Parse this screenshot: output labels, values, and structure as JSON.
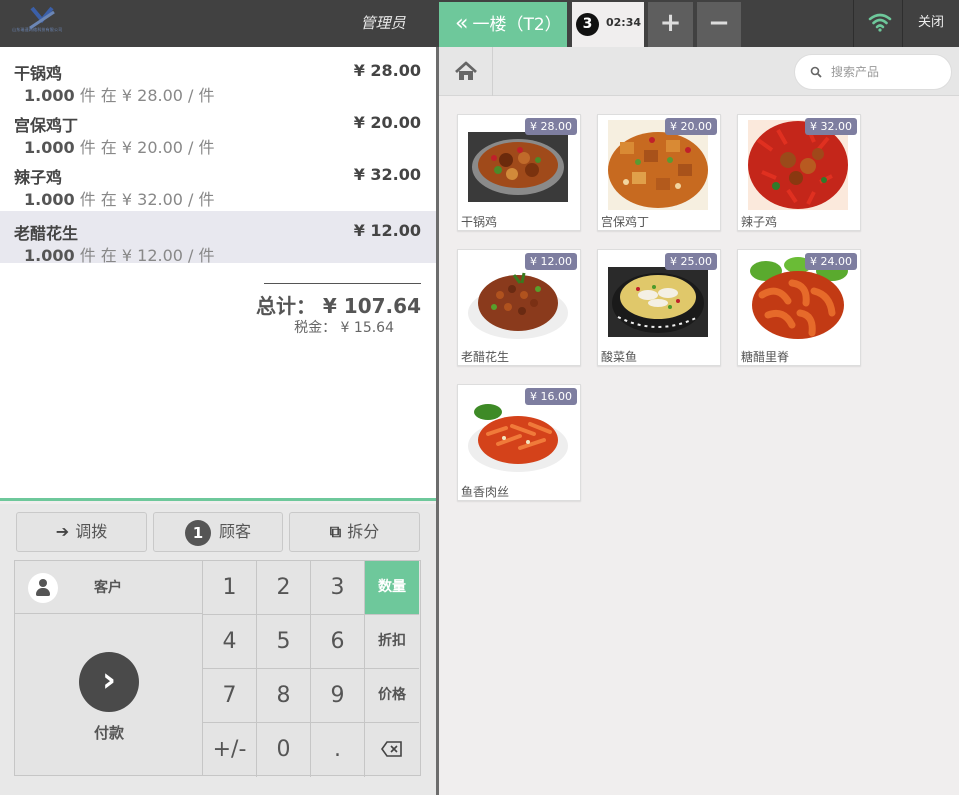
{
  "header": {
    "logo_text": "山东瑞速网络科技有限公司",
    "username": "管理员",
    "floor_label": "一楼（T2）",
    "order_number": "3",
    "order_time": "02:34",
    "add_label": "+",
    "remove_label": "−",
    "close_label": "关闭"
  },
  "order": {
    "lines": [
      {
        "name": "干锅鸡",
        "price": "¥ 28.00",
        "qty": "1.000",
        "info": " 件 在 ¥ 28.00 / 件"
      },
      {
        "name": "宫保鸡丁",
        "price": "¥ 20.00",
        "qty": "1.000",
        "info": " 件 在 ¥ 20.00 / 件"
      },
      {
        "name": "辣子鸡",
        "price": "¥ 32.00",
        "qty": "1.000",
        "info": " 件 在 ¥ 32.00 / 件"
      },
      {
        "name": "老醋花生",
        "price": "¥ 12.00",
        "qty": "1.000",
        "info": " 件 在 ¥ 12.00 / 件"
      }
    ],
    "total": "总计：  ¥ 107.64",
    "tax": "税金：  ¥ 15.64"
  },
  "controls": {
    "transfer_label": "调拨",
    "guests_count": "1",
    "guests_label": "顾客",
    "split_label": "拆分",
    "customer_label": "客户",
    "pay_label": "付款"
  },
  "numpad": {
    "keys": [
      "1",
      "2",
      "3",
      "4",
      "5",
      "6",
      "7",
      "8",
      "9",
      "+/-",
      "0",
      "."
    ],
    "modes": [
      "数量",
      "折扣",
      "价格"
    ],
    "active_mode": "数量"
  },
  "search": {
    "placeholder": "搜索产品"
  },
  "products": [
    {
      "name": "干锅鸡",
      "price": "¥ 28.00"
    },
    {
      "name": "宫保鸡丁",
      "price": "¥ 20.00"
    },
    {
      "name": "辣子鸡",
      "price": "¥ 32.00"
    },
    {
      "name": "老醋花生",
      "price": "¥ 12.00"
    },
    {
      "name": "酸菜鱼",
      "price": "¥ 25.00"
    },
    {
      "name": "糖醋里脊",
      "price": "¥ 24.00"
    },
    {
      "name": "鱼香肉丝",
      "price": "¥ 16.00"
    }
  ],
  "colors": {
    "accent": "#6ec89b",
    "header": "#414141",
    "price_badge": "#7e7ea0"
  }
}
